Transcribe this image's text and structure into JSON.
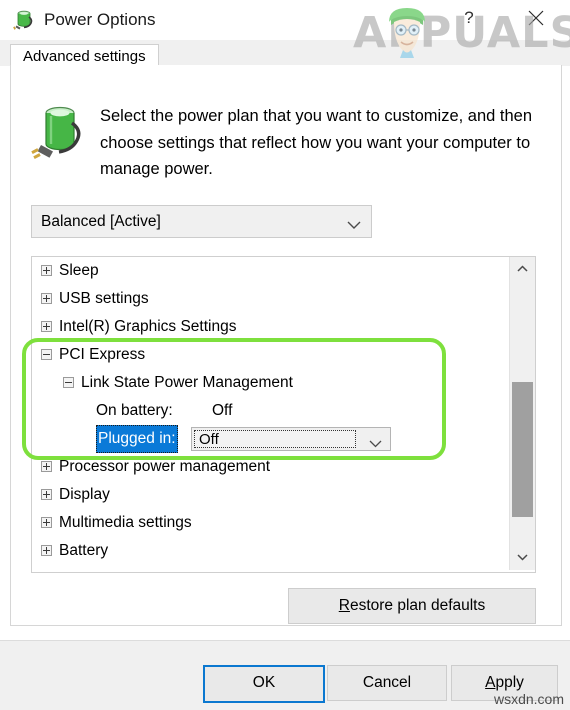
{
  "window": {
    "title": "Power Options",
    "icon": "battery-plug-icon",
    "help_label": "?",
    "close_label": "close-icon"
  },
  "tabs": [
    {
      "label": "Advanced settings",
      "selected": true
    }
  ],
  "description": {
    "icon": "battery-plug-icon",
    "text": "Select the power plan that you want to customize, and then choose settings that reflect how you want your computer to manage power."
  },
  "plan_combo": {
    "value": "Balanced [Active]",
    "arrow": "chevron-down-icon"
  },
  "tree": {
    "rows": [
      {
        "depth": 0,
        "state": "plus",
        "label": "Sleep"
      },
      {
        "depth": 0,
        "state": "plus",
        "label": "USB settings"
      },
      {
        "depth": 0,
        "state": "plus",
        "label": "Intel(R) Graphics Settings"
      },
      {
        "depth": 0,
        "state": "minus",
        "label": "PCI Express"
      },
      {
        "depth": 1,
        "state": "minus",
        "label": "Link State Power Management"
      },
      {
        "depth": 2,
        "state": "none",
        "label": "On battery:",
        "value": "Off",
        "kind": "value"
      },
      {
        "depth": 2,
        "state": "none",
        "label": "Plugged in:",
        "value": "Off",
        "kind": "combo",
        "selected": true
      },
      {
        "depth": 0,
        "state": "plus",
        "label": "Processor power management"
      },
      {
        "depth": 0,
        "state": "plus",
        "label": "Display"
      },
      {
        "depth": 0,
        "state": "plus",
        "label": "Multimedia settings"
      },
      {
        "depth": 0,
        "state": "plus",
        "label": "Battery"
      }
    ],
    "scrollbar": {
      "up_arrow": "chevron-up-icon",
      "down_arrow": "chevron-down-icon",
      "thumb_top_pct": 38,
      "thumb_height_pct": 51
    }
  },
  "restore_button": {
    "accel": "R",
    "rest": "estore plan defaults"
  },
  "footer": {
    "ok": "OK",
    "cancel": "Cancel",
    "apply_accel": "A",
    "apply_rest": "pply"
  },
  "annotation": {
    "color": "#7ee03d",
    "shape": "rounded-rectangle"
  },
  "watermarks": {
    "brand": "APPUALS",
    "source": "wsxdn.com"
  },
  "colors": {
    "selection_blue": "#0a7ad8",
    "value_link_blue": "#2f6fb5",
    "default_button_border": "#0b78d0",
    "annotation_green": "#7ee03d",
    "panel_bg": "#ffffff",
    "chrome_bg": "#f0f0f0"
  }
}
